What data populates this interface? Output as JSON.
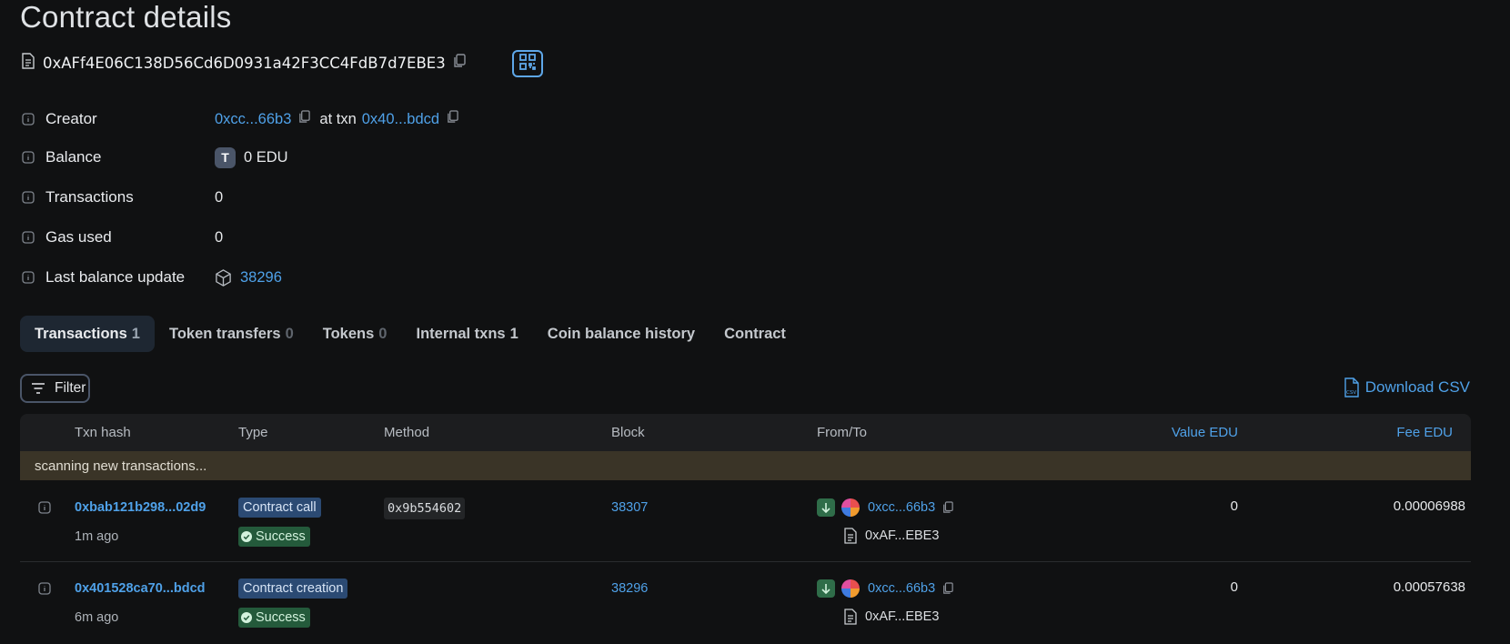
{
  "page": {
    "title": "Contract details"
  },
  "contract": {
    "address": "0xAFf4E06C138D56Cd6D0931a42F3CC4FdB7d7EBE3"
  },
  "details": {
    "creator": {
      "label": "Creator",
      "address": "0xcc...66b3",
      "at_txn": "at txn",
      "txn": "0x40...bdcd"
    },
    "balance": {
      "label": "Balance",
      "token_letter": "T",
      "value": "0 EDU"
    },
    "transactions": {
      "label": "Transactions",
      "value": "0"
    },
    "gas_used": {
      "label": "Gas used",
      "value": "0"
    },
    "last_balance_update": {
      "label": "Last balance update",
      "block": "38296"
    }
  },
  "tabs": [
    {
      "label": "Transactions",
      "count": "1"
    },
    {
      "label": "Token transfers",
      "count": "0"
    },
    {
      "label": "Tokens",
      "count": "0"
    },
    {
      "label": "Internal txns",
      "count": "1"
    },
    {
      "label": "Coin balance history"
    },
    {
      "label": "Contract"
    }
  ],
  "toolbar": {
    "filter_label": "Filter",
    "download_label": "Download CSV"
  },
  "table": {
    "columns": {
      "txn_hash": "Txn hash",
      "type": "Type",
      "method": "Method",
      "block": "Block",
      "from_to": "From/To",
      "value": "Value EDU",
      "fee": "Fee EDU"
    },
    "scanning_text": "scanning new transactions...",
    "rows": [
      {
        "hash": "0xbab121b298...02d9",
        "age": "1m ago",
        "type": "Contract call",
        "status": "Success",
        "method": "0x9b554602",
        "block": "38307",
        "from": "0xcc...66b3",
        "to": "0xAF...EBE3",
        "value": "0",
        "fee": "0.00006988"
      },
      {
        "hash": "0x401528ca70...bdcd",
        "age": "6m ago",
        "type": "Contract creation",
        "status": "Success",
        "method": "",
        "block": "38296",
        "from": "0xcc...66b3",
        "to": "0xAF...EBE3",
        "value": "0",
        "fee": "0.00057638"
      }
    ]
  },
  "colors": {
    "background": "#101112",
    "link": "#4fa1e8",
    "success": "#245a3b",
    "type_badge": "#2b4a73",
    "scanning_bar": "#3a3427"
  }
}
